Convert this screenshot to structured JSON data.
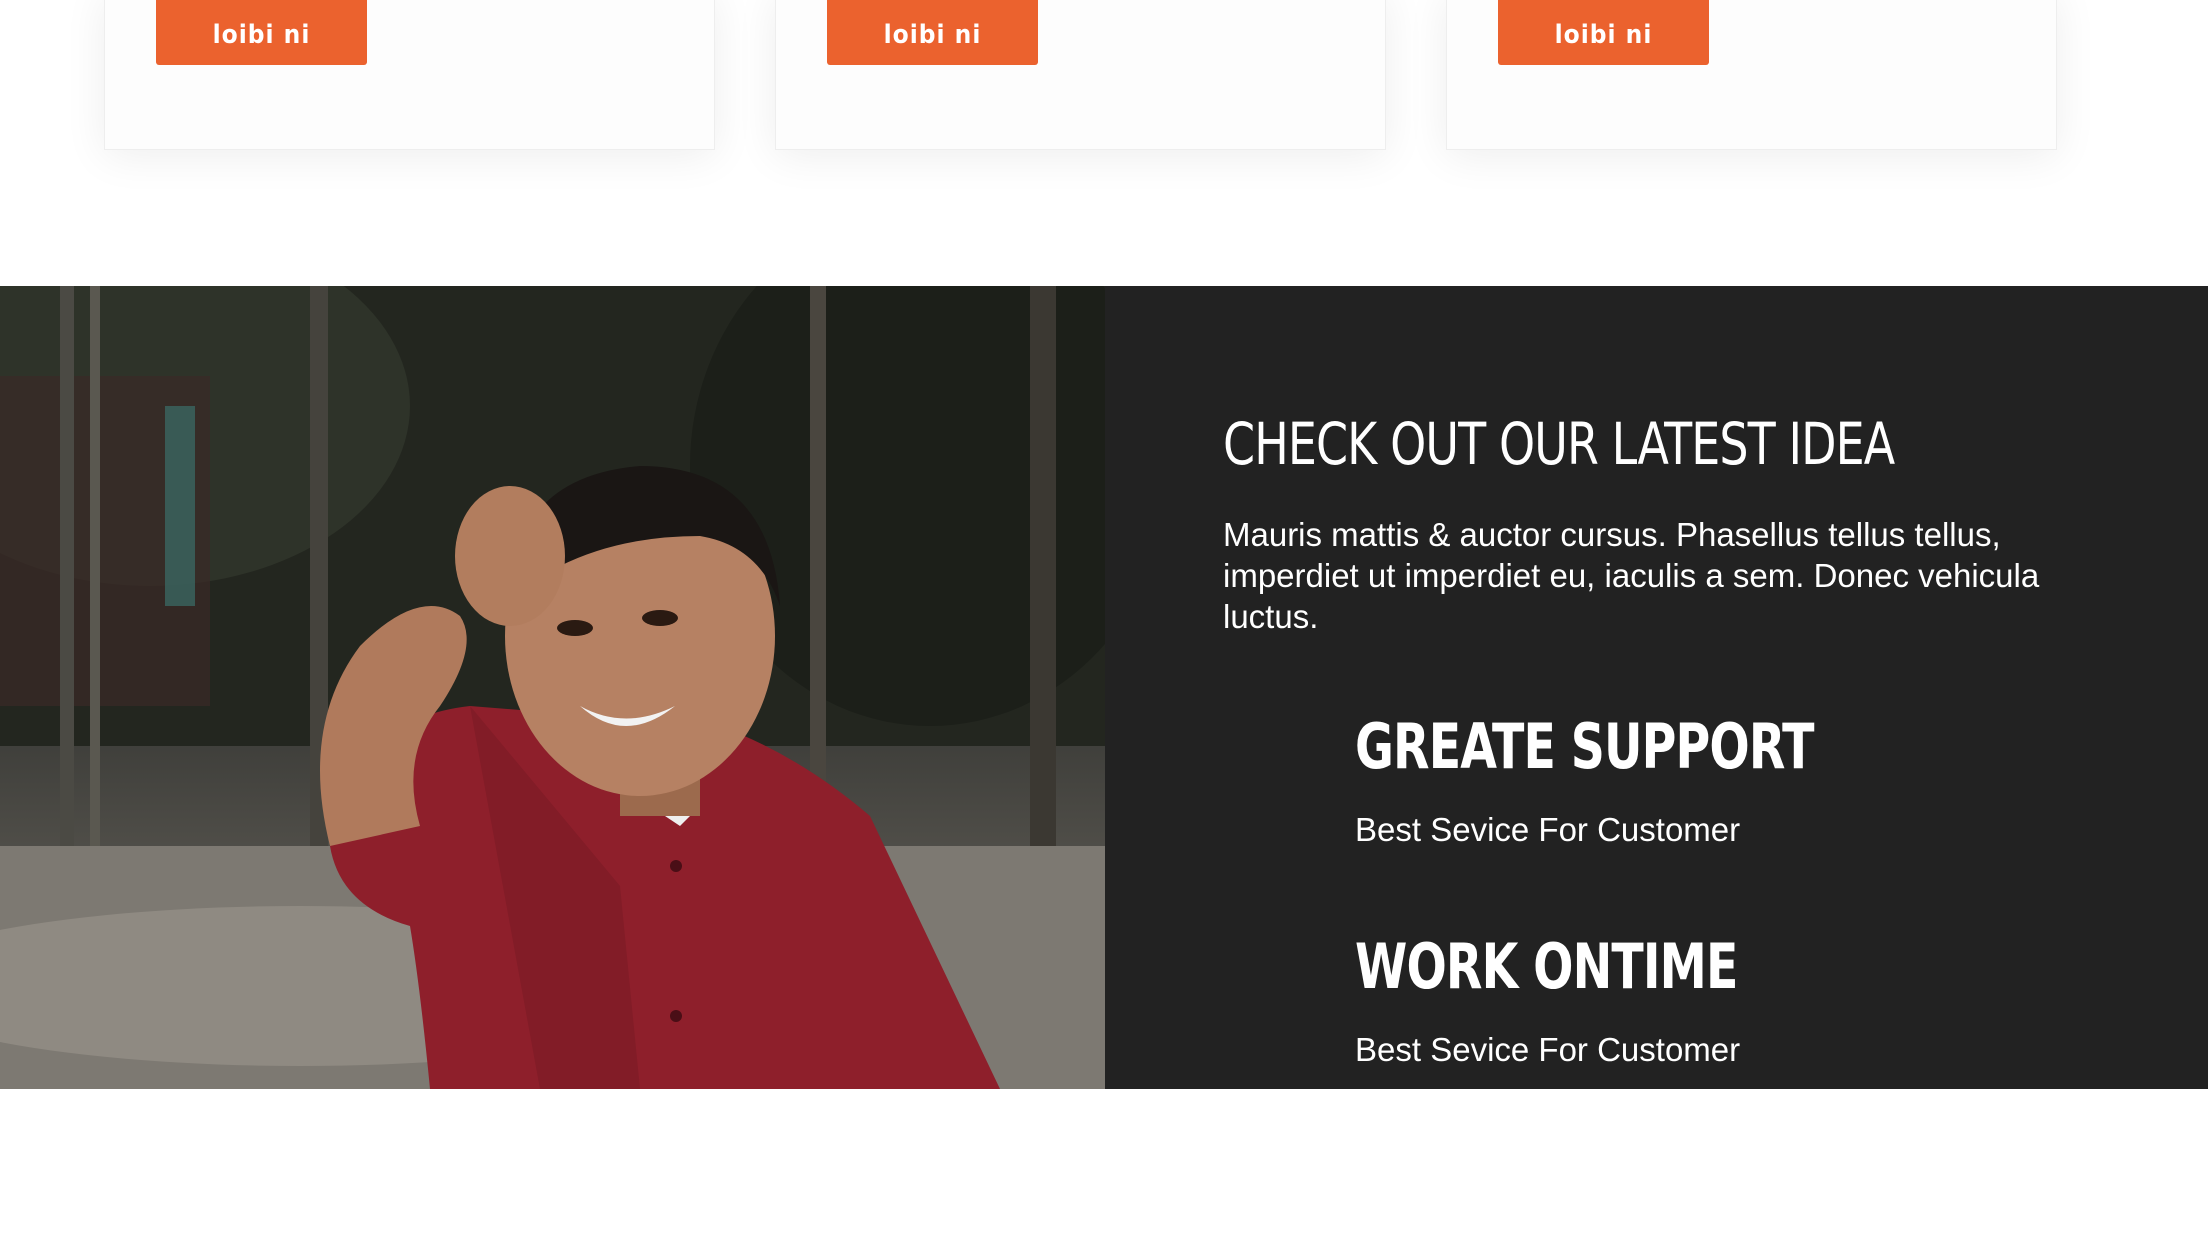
{
  "cards": [
    {
      "button_label": "loibi ni"
    },
    {
      "button_label": "loibi ni"
    },
    {
      "button_label": "loibi ni"
    }
  ],
  "feature": {
    "image_alt": "Smiling boy in red shirt",
    "title": "CHECK OUT OUR LATEST IDEA",
    "description": "Mauris mattis & auctor cursus. Phasellus tellus tellus, imperdiet ut imperdiet eu, iaculis a sem. Donec vehicula luctus.",
    "services": [
      {
        "title": "GREATE SUPPORT",
        "subtitle": "Best Sevice For Customer"
      },
      {
        "title": "WORK ONTIME",
        "subtitle": "Best Sevice For Customer"
      }
    ]
  },
  "colors": {
    "accent": "#eb622e",
    "panel_bg": "#222222",
    "card_bg": "#fdfdfd"
  }
}
